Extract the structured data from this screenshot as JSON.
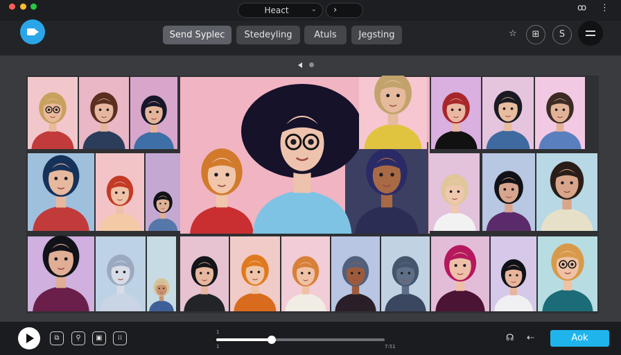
{
  "titlebar": {
    "address": "Heact",
    "nav_next": "›",
    "right_icon_1": "ꝏ",
    "right_icon_2": "⋮"
  },
  "toolbar": {
    "tabs": [
      {
        "label": "Send Syplec",
        "active": true
      },
      {
        "label": "Stedeyling",
        "active": false
      },
      {
        "label": "Atuls",
        "active": false
      },
      {
        "label": "Jegsting",
        "active": false
      }
    ],
    "icon_star": "☆",
    "icon_book": "⊞",
    "icon_s": "S"
  },
  "carousel": {
    "pages": 2,
    "current": 0
  },
  "grid": {
    "tiles": [
      {
        "bg": "#f2c7cc",
        "hair": "#c8a15f",
        "skin": "#e8b99a",
        "shirt": "#c23b3b",
        "glasses": true
      },
      {
        "bg": "#e9b7c6",
        "hair": "#5a2f22",
        "skin": "#e6b79e",
        "shirt": "#2c3d5c"
      },
      {
        "bg": "#d8a6cb",
        "hair": "#15162a",
        "skin": "#e4b49a",
        "shirt": "#3e6fa6"
      },
      {
        "bg": "#f6c7d0",
        "hair": "#c2a36c",
        "skin": "#e6ba9d",
        "shirt": "#e0c440"
      },
      {
        "bg": "#d9b0df",
        "hair": "#a8262a",
        "skin": "#eab7a2",
        "shirt": "#111111"
      },
      {
        "bg": "#e5c4de",
        "hair": "#1a1b22",
        "skin": "#e7bc9f",
        "shirt": "#3e6aa0"
      },
      {
        "bg": "#f2c9e2",
        "hair": "#3c2b24",
        "skin": "#e1b296",
        "shirt": "#5a7fbf"
      },
      {
        "bg": "#9fc0dd",
        "hair": "#16325a",
        "skin": "#e6b99f",
        "shirt": "#c23b3b"
      },
      {
        "bg": "#f3c4c7",
        "hair": "#c33a25",
        "skin": "#efc1a8",
        "shirt": "#f4c9a6"
      },
      {
        "bg": "#c4a8d2",
        "hair": "#111218",
        "skin": "#e0b094",
        "shirt": "#5577aa"
      },
      {
        "bg": "#e3c2dc",
        "hair": "#e0c79a",
        "skin": "#efc8ae",
        "shirt": "#f2f2f2"
      },
      {
        "bg": "#b8c7e2",
        "hair": "#111218",
        "skin": "#d7a58e",
        "shirt": "#5a2a6a"
      },
      {
        "bg": "#b7d8e4",
        "hair": "#2a1d18",
        "skin": "#d8a58a",
        "shirt": "#e7e0c8"
      },
      {
        "bg": "#cfb0df",
        "hair": "#111218",
        "skin": "#dfae95",
        "shirt": "#6a1e4a"
      },
      {
        "bg": "#bdd2e4",
        "hair": "#9aa9bf",
        "skin": "#d7dce6",
        "shirt": "#c9d4e4"
      },
      {
        "bg": "#c6dbe3",
        "hair": "#d7c39a",
        "skin": "#c69270",
        "shirt": "#3e5f98"
      },
      {
        "bg": "#e7c3d2",
        "hair": "#14151b",
        "skin": "#e7b79f",
        "shirt": "#222428"
      },
      {
        "bg": "#f1cbc8",
        "hair": "#e0791e",
        "skin": "#f0c4a8",
        "shirt": "#d86b1d"
      },
      {
        "bg": "#f2ccd6",
        "hair": "#d7803a",
        "skin": "#f0c2a5",
        "shirt": "#f1ece4"
      },
      {
        "bg": "#b8c6e4",
        "hair": "#52607c",
        "skin": "#9e5b3b",
        "shirt": "#2a1f28"
      },
      {
        "bg": "#c1d2e2",
        "hair": "#45556b",
        "skin": "#5e6e86",
        "shirt": "#3b4760"
      },
      {
        "bg": "#e3bcd8",
        "hair": "#b5185e",
        "skin": "#efc0a9",
        "shirt": "#4b1434"
      },
      {
        "bg": "#d6c8e8",
        "hair": "#111218",
        "skin": "#e6b59c",
        "shirt": "#f0eff1"
      },
      {
        "bg": "#b7dde2",
        "hair": "#d89a4a",
        "skin": "#efc2a5",
        "shirt": "#1c6b79",
        "glasses": true
      }
    ],
    "feature": {
      "bg": "#f1b4c3",
      "hair": "#15122a",
      "skin": "#eec3ad",
      "shirt": "#7ec3e4",
      "glasses": true
    },
    "feature_left": {
      "hair": "#d27a2c",
      "skin": "#f1c6aa",
      "shirt": "#c92f31"
    },
    "feature_right": {
      "hair": "#2a2a66",
      "skin": "#a76a44",
      "shirt": "#2b2d55"
    }
  },
  "player": {
    "progress": 0.33,
    "time_top": "1",
    "time_bottom": "1",
    "time_right": "7:51",
    "icon_1": "⧉",
    "icon_2": "⚲",
    "icon_3": "▣",
    "icon_4": "⁞⁞",
    "right_icon_1": "☊",
    "right_icon_2": "⇠",
    "ask_label": "Aok"
  }
}
